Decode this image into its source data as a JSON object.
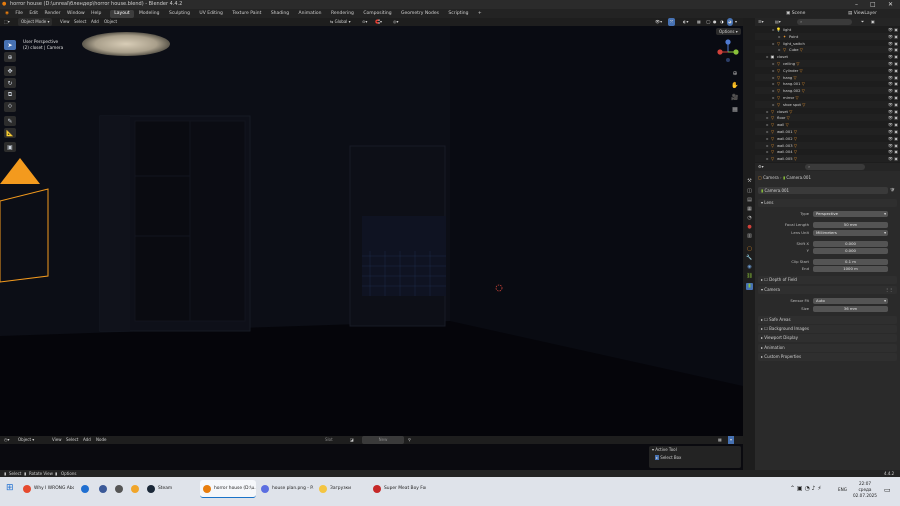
{
  "titlebar": {
    "title": "horror house (D:\\unreal\\блендер\\horror house.blend) - Blender 4.4.2"
  },
  "menu": {
    "items": [
      "File",
      "Edit",
      "Render",
      "Window",
      "Help"
    ]
  },
  "workspaces": [
    "Layout",
    "Modeling",
    "Sculpting",
    "UV Editing",
    "Texture Paint",
    "Shading",
    "Animation",
    "Rendering",
    "Compositing",
    "Geometry Nodes",
    "Scripting"
  ],
  "scene": {
    "scene_label": "Scene",
    "view_layer": "ViewLayer"
  },
  "viewport": {
    "mode": "Object Mode",
    "header_menus": [
      "View",
      "Select",
      "Add",
      "Object"
    ],
    "orientation": "Global",
    "options": "Options",
    "overlay_title": "User Perspective",
    "overlay_sub": "(2) closet | Camera"
  },
  "timeline": {
    "mode": "Object",
    "menus": [
      "View",
      "Select",
      "Add",
      "Node"
    ],
    "slot": "Slot",
    "new": "New"
  },
  "active_tool": {
    "title": "Active Tool",
    "tool": "Select Box"
  },
  "statusbar": {
    "select": "Select",
    "rotate": "Rotate View",
    "options": "Options",
    "version": "4.4.2"
  },
  "outliner": {
    "search_placeholder": "",
    "rows": [
      {
        "name": "light",
        "icon": "light-icon",
        "indent": 2,
        "tri": false
      },
      {
        "name": "Point",
        "icon": "point-light-icon",
        "indent": 3,
        "tri": false
      },
      {
        "name": "light_switch",
        "icon": "mesh-icon",
        "indent": 2,
        "tri": false
      },
      {
        "name": "Cube",
        "icon": "mesh-icon",
        "indent": 3,
        "tri": true
      },
      {
        "name": "closet",
        "icon": "collection-icon",
        "indent": 1,
        "tri": false
      },
      {
        "name": "ceiling",
        "icon": "mesh-icon",
        "indent": 2,
        "tri": true
      },
      {
        "name": "Cylinder",
        "icon": "mesh-icon",
        "indent": 2,
        "tri": true
      },
      {
        "name": "hang",
        "icon": "mesh-icon",
        "indent": 2,
        "tri": true
      },
      {
        "name": "hang.001",
        "icon": "mesh-icon",
        "indent": 2,
        "tri": true
      },
      {
        "name": "hang.002",
        "icon": "mesh-icon",
        "indent": 2,
        "tri": true
      },
      {
        "name": "mirror",
        "icon": "mesh-icon",
        "indent": 2,
        "tri": true
      },
      {
        "name": "shoe spot",
        "icon": "mesh-icon",
        "indent": 2,
        "tri": true
      },
      {
        "name": "closet",
        "icon": "mesh-icon",
        "indent": 1,
        "tri": true
      },
      {
        "name": "floor",
        "icon": "mesh-icon",
        "indent": 1,
        "tri": true
      },
      {
        "name": "wall",
        "icon": "mesh-icon",
        "indent": 1,
        "tri": true
      },
      {
        "name": "wall.001",
        "icon": "mesh-icon",
        "indent": 1,
        "tri": true
      },
      {
        "name": "wall.002",
        "icon": "mesh-icon",
        "indent": 1,
        "tri": true
      },
      {
        "name": "wall.003",
        "icon": "mesh-icon",
        "indent": 1,
        "tri": true
      },
      {
        "name": "wall.004",
        "icon": "mesh-icon",
        "indent": 1,
        "tri": true
      },
      {
        "name": "wall.005",
        "icon": "mesh-icon",
        "indent": 1,
        "tri": true
      }
    ]
  },
  "properties": {
    "breadcrumb_obj": "Camera",
    "breadcrumb_data": "Camera.001",
    "datablock": "Camera.001",
    "lens_panel": "Lens",
    "type_label": "Type",
    "type_value": "Perspective",
    "focal_label": "Focal Length",
    "focal_value": "50 mm",
    "lens_unit_label": "Lens Unit",
    "lens_unit_value": "Millimeters",
    "shiftx_label": "Shift X",
    "shiftx_value": "0.000",
    "shifty_label": "Y",
    "shifty_value": "0.000",
    "clipstart_label": "Clip Start",
    "clipstart_value": "0.1 m",
    "clipend_label": "End",
    "clipend_value": "1000 m",
    "dof_panel": "Depth of Field",
    "camera_panel": "Camera",
    "sensorfit_label": "Sensor Fit",
    "sensorfit_value": "Auto",
    "size_label": "Size",
    "size_value": "36 mm",
    "safe_panel": "Safe Areas",
    "bg_panel": "Background Images",
    "vd_panel": "Viewport Display",
    "anim_panel": "Animation",
    "custom_panel": "Custom Properties"
  },
  "taskbar": {
    "apps": [
      {
        "label": "Why I WRONG Abo...",
        "color": "#e64a2e"
      },
      {
        "label": "",
        "color": "#1f6fd1"
      },
      {
        "label": "",
        "color": "#3b5998"
      },
      {
        "label": "",
        "color": "#555"
      },
      {
        "label": "",
        "color": "#f1a52a"
      },
      {
        "label": "",
        "color": "#6c6c6c"
      },
      {
        "label": "Steam",
        "color": "#1b2838"
      },
      {
        "label": "horror house (D:\\u...",
        "color": "#e87d0d"
      },
      {
        "label": "house plan.png - P...",
        "color": "#5b6ee1"
      },
      {
        "label": "Загрузки",
        "color": "#f4c542"
      },
      {
        "label": "Super Meat Boy For...",
        "color": "#c62828"
      }
    ],
    "lang": "ENG",
    "time": "22:07",
    "day": "среда",
    "date": "02.07.2025"
  },
  "colors": {
    "accent": "#4772b3",
    "camera": "#e9942d",
    "light": "#e9942d"
  }
}
